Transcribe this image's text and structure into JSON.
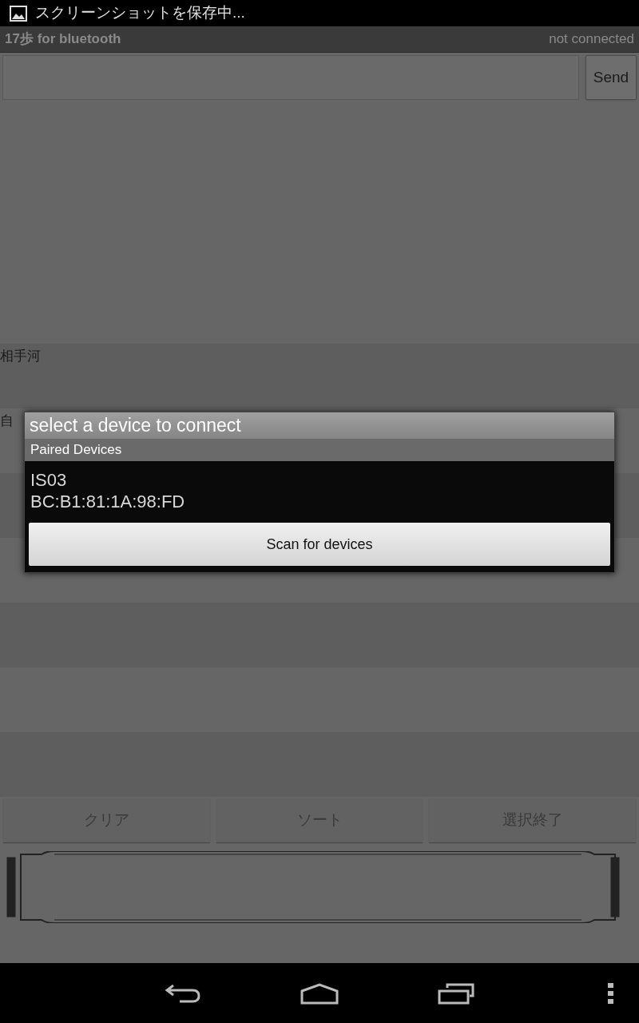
{
  "status_bar": {
    "notification": "スクリーンショットを保存中..."
  },
  "title_bar": {
    "title": "17歩 for bluetooth",
    "connection": "not connected"
  },
  "send_button": "Send",
  "rows": [
    {
      "label": "相手河"
    },
    {
      "label": "自"
    }
  ],
  "buttons": [
    "クリア",
    "ソート",
    "選択終了"
  ],
  "dialog": {
    "title": "select a device to connect",
    "section": "Paired Devices",
    "devices": [
      {
        "name": "IS03",
        "address": "BC:B1:81:1A:98:FD"
      }
    ],
    "scan_button": "Scan for devices"
  }
}
